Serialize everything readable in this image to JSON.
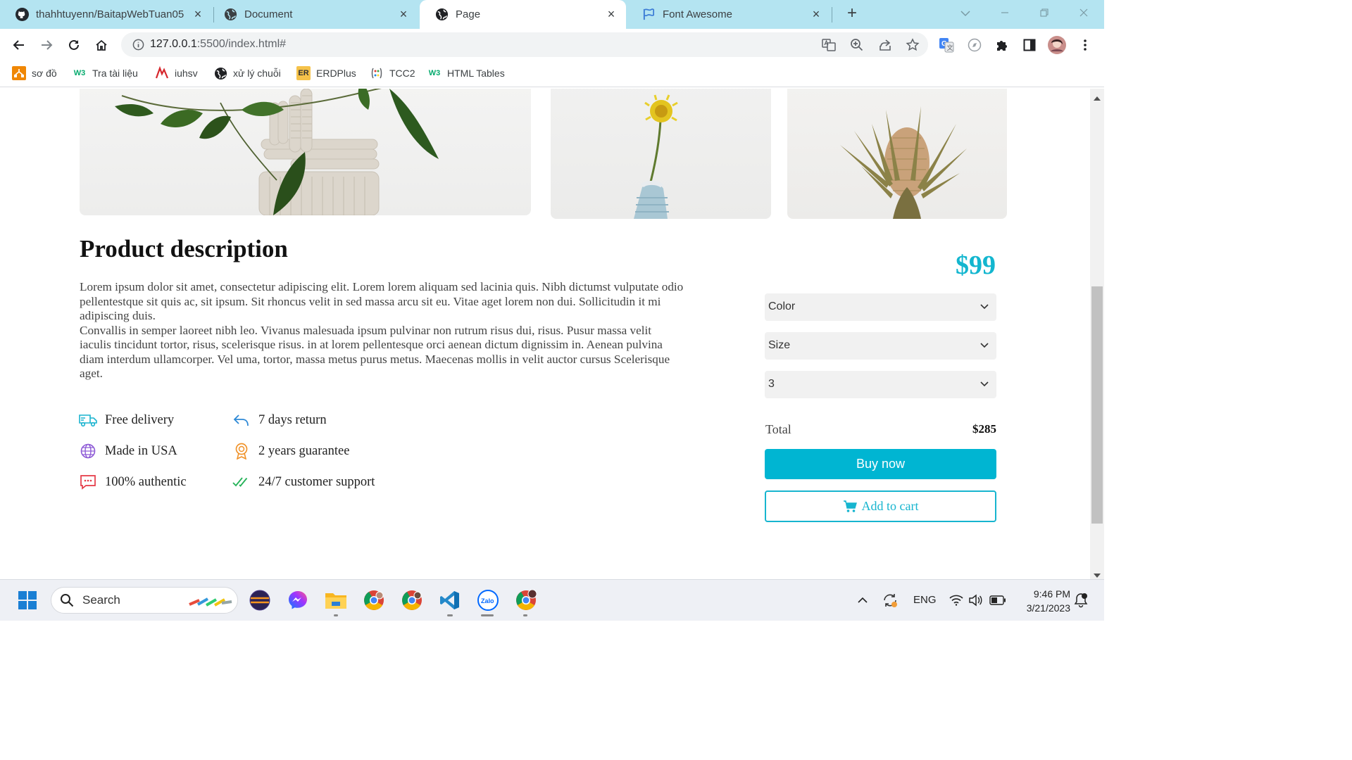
{
  "browser": {
    "tabs": [
      {
        "title": "thahhtuyenn/BaitapWebTuan05",
        "icon": "github-icon"
      },
      {
        "title": "Document",
        "icon": "globe-icon"
      },
      {
        "title": "Page",
        "icon": "globe-icon",
        "active": true
      },
      {
        "title": "Font Awesome",
        "icon": "flag-icon"
      }
    ],
    "url_host": "127.0.0.1",
    "url_path": ":5500/index.html#",
    "bookmarks": [
      {
        "label": "sơ đồ"
      },
      {
        "label": "Tra tài liệu"
      },
      {
        "label": "iuhsv"
      },
      {
        "label": "xử lý chuỗi"
      },
      {
        "label": "ERDPlus"
      },
      {
        "label": "TCC2"
      },
      {
        "label": "HTML Tables"
      }
    ],
    "bookmark_badges": {
      "erdplus": "ER",
      "w3": "W3"
    }
  },
  "product": {
    "heading": "Product description",
    "paragraphs": [
      "Lorem ipsum dolor sit amet, consectetur adipiscing elit. Lorem lorem aliquam sed lacinia quis. Nibh dictumst vulputate odio pellentestque sit quis ac, sit ipsum. Sit rhoncus velit in sed massa arcu sit eu. Vitae aget lorem non dui. Sollicitudin it mi adipiscing duis.",
      "Convallis in semper laoreet nibh leo. Vivanus malesuada ipsum pulvinar non rutrum risus dui, risus. Pusur massa velit iaculis tincidunt tortor, risus, scelerisque risus. in at lorem pellentesque orci aenean dictum dignissim in. Aenean pulvina diam interdum ullamcorper. Vel uma, tortor, massa metus purus metus. Maecenas mollis in velit auctor cursus Scelerisque aget."
    ],
    "features": [
      {
        "label": "Free delivery",
        "icon": "truck-icon"
      },
      {
        "label": "7 days return",
        "icon": "return-arrow-icon"
      },
      {
        "label": "Made in USA",
        "icon": "globe-icon"
      },
      {
        "label": "2 years guarantee",
        "icon": "award-icon"
      },
      {
        "label": "100% authentic",
        "icon": "chat-icon"
      },
      {
        "label": "24/7 customer support",
        "icon": "double-check-icon"
      }
    ],
    "price": "$99",
    "selects": {
      "color": "Color",
      "size": "Size",
      "quantity": "3"
    },
    "total_label": "Total",
    "total_value": "$285",
    "buy_label": "Buy now",
    "cart_label": "Add to cart",
    "accent_color": "#00b5d2"
  },
  "taskbar": {
    "search_placeholder": "Search",
    "language": "ENG",
    "time": "9:46 PM",
    "date": "3/21/2023"
  }
}
